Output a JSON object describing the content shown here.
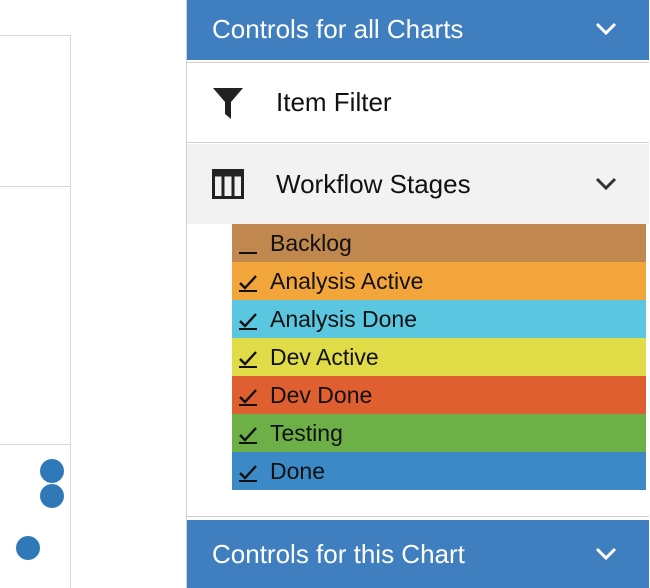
{
  "chart": {
    "dots": 3
  },
  "panel": {
    "all_charts_title": "Controls for all Charts",
    "item_filter_label": "Item Filter",
    "workflow_title": "Workflow Stages",
    "this_chart_title": "Controls for this Chart"
  },
  "stages": [
    {
      "label": "Backlog",
      "checked": false,
      "color": "#c0874e"
    },
    {
      "label": "Analysis Active",
      "checked": true,
      "color": "#f2a53a"
    },
    {
      "label": "Analysis Done",
      "checked": true,
      "color": "#5bc6e0"
    },
    {
      "label": "Dev Active",
      "checked": true,
      "color": "#dfdc47"
    },
    {
      "label": "Dev Done",
      "checked": true,
      "color": "#e05f31"
    },
    {
      "label": "Testing",
      "checked": true,
      "color": "#6db048"
    },
    {
      "label": "Done",
      "checked": true,
      "color": "#3c89c7"
    }
  ]
}
